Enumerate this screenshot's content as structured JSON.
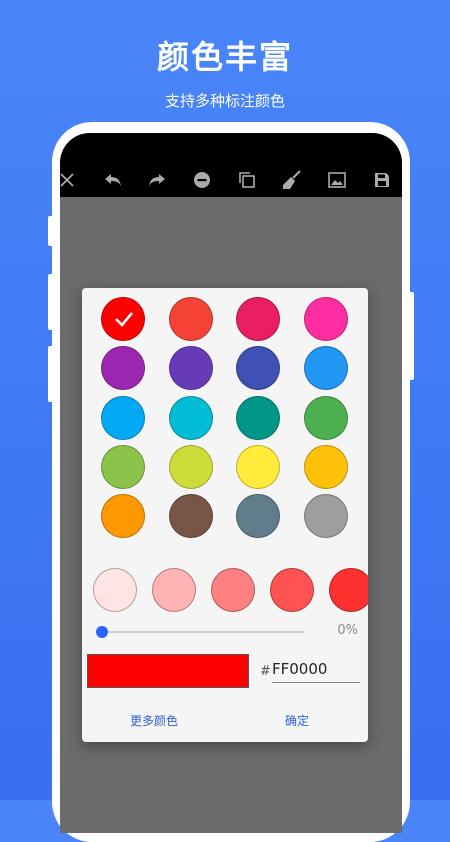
{
  "header": {
    "title": "颜色丰富",
    "subtitle": "支持多种标注颜色"
  },
  "toolbar": {
    "icons": [
      "close-icon",
      "undo-icon",
      "redo-icon",
      "minus-circle-icon",
      "copy-icon",
      "broom-icon",
      "image-icon",
      "save-icon"
    ]
  },
  "palette": {
    "selected_index": 0,
    "colors": [
      "#ff0000",
      "#f44336",
      "#e91e63",
      "#ff2d9f",
      "#9c27b0",
      "#673ab7",
      "#3f51b5",
      "#2196f3",
      "#03a9f4",
      "#00bcd4",
      "#009688",
      "#4caf50",
      "#8bc34a",
      "#cddc39",
      "#ffeb3b",
      "#ffc107",
      "#ff9800",
      "#795548",
      "#607d8b",
      "#9e9e9e"
    ]
  },
  "shades": [
    "#ffe4e4",
    "#ffb3b3",
    "#ff8080",
    "#ff5252",
    "#ff3030"
  ],
  "opacity": {
    "value": 0,
    "label": "0%"
  },
  "current": {
    "preview_color": "#ff0000",
    "hash": "#",
    "hex": "FF0000"
  },
  "buttons": {
    "more_colors": "更多颜色",
    "confirm": "确定"
  },
  "colors": {
    "accent": "#2962ff"
  }
}
